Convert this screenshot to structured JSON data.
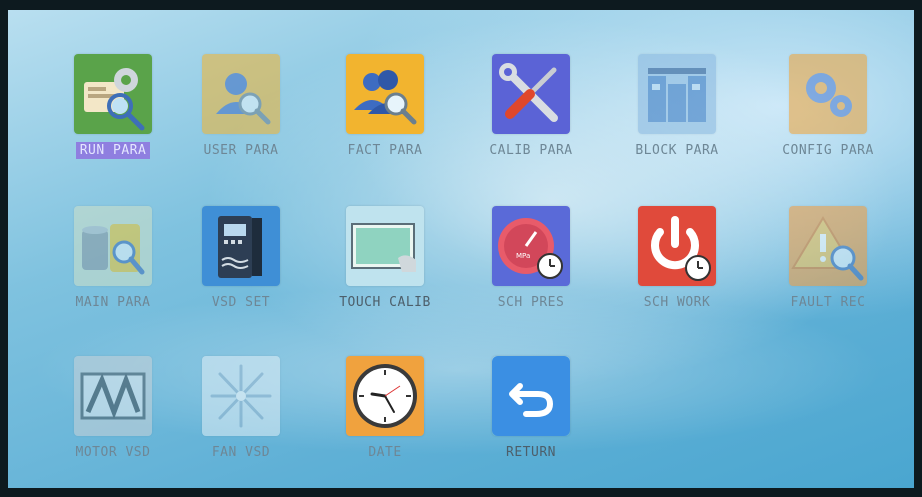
{
  "menu": {
    "items": [
      {
        "label": "RUN  PARA",
        "icon": "run-para-icon"
      },
      {
        "label": "USER  PARA",
        "icon": "user-para-icon"
      },
      {
        "label": "FACT  PARA",
        "icon": "fact-para-icon"
      },
      {
        "label": "CALIB  PARA",
        "icon": "calib-para-icon"
      },
      {
        "label": "BLOCK  PARA",
        "icon": "block-para-icon"
      },
      {
        "label": "CONFIG  PARA",
        "icon": "config-para-icon"
      },
      {
        "label": "MAIN  PARA",
        "icon": "main-para-icon"
      },
      {
        "label": "VSD  SET",
        "icon": "vsd-set-icon"
      },
      {
        "label": "TOUCH  CALIB",
        "icon": "touch-calib-icon"
      },
      {
        "label": "SCH  PRES",
        "icon": "sch-pres-icon"
      },
      {
        "label": "SCH  WORK",
        "icon": "sch-work-icon"
      },
      {
        "label": "FAULT  REC",
        "icon": "fault-rec-icon"
      },
      {
        "label": "MOTOR  VSD",
        "icon": "motor-vsd-icon"
      },
      {
        "label": "FAN  VSD",
        "icon": "fan-vsd-icon"
      },
      {
        "label": "DATE",
        "icon": "date-icon"
      },
      {
        "label": "RETURN",
        "icon": "return-icon"
      }
    ],
    "selected": "RUN  PARA",
    "mps_text": "MPa"
  },
  "colors": {
    "selected_label_bg": "#8f7fe0",
    "background": "#5fb0d6",
    "label_text": "#6e8796"
  }
}
